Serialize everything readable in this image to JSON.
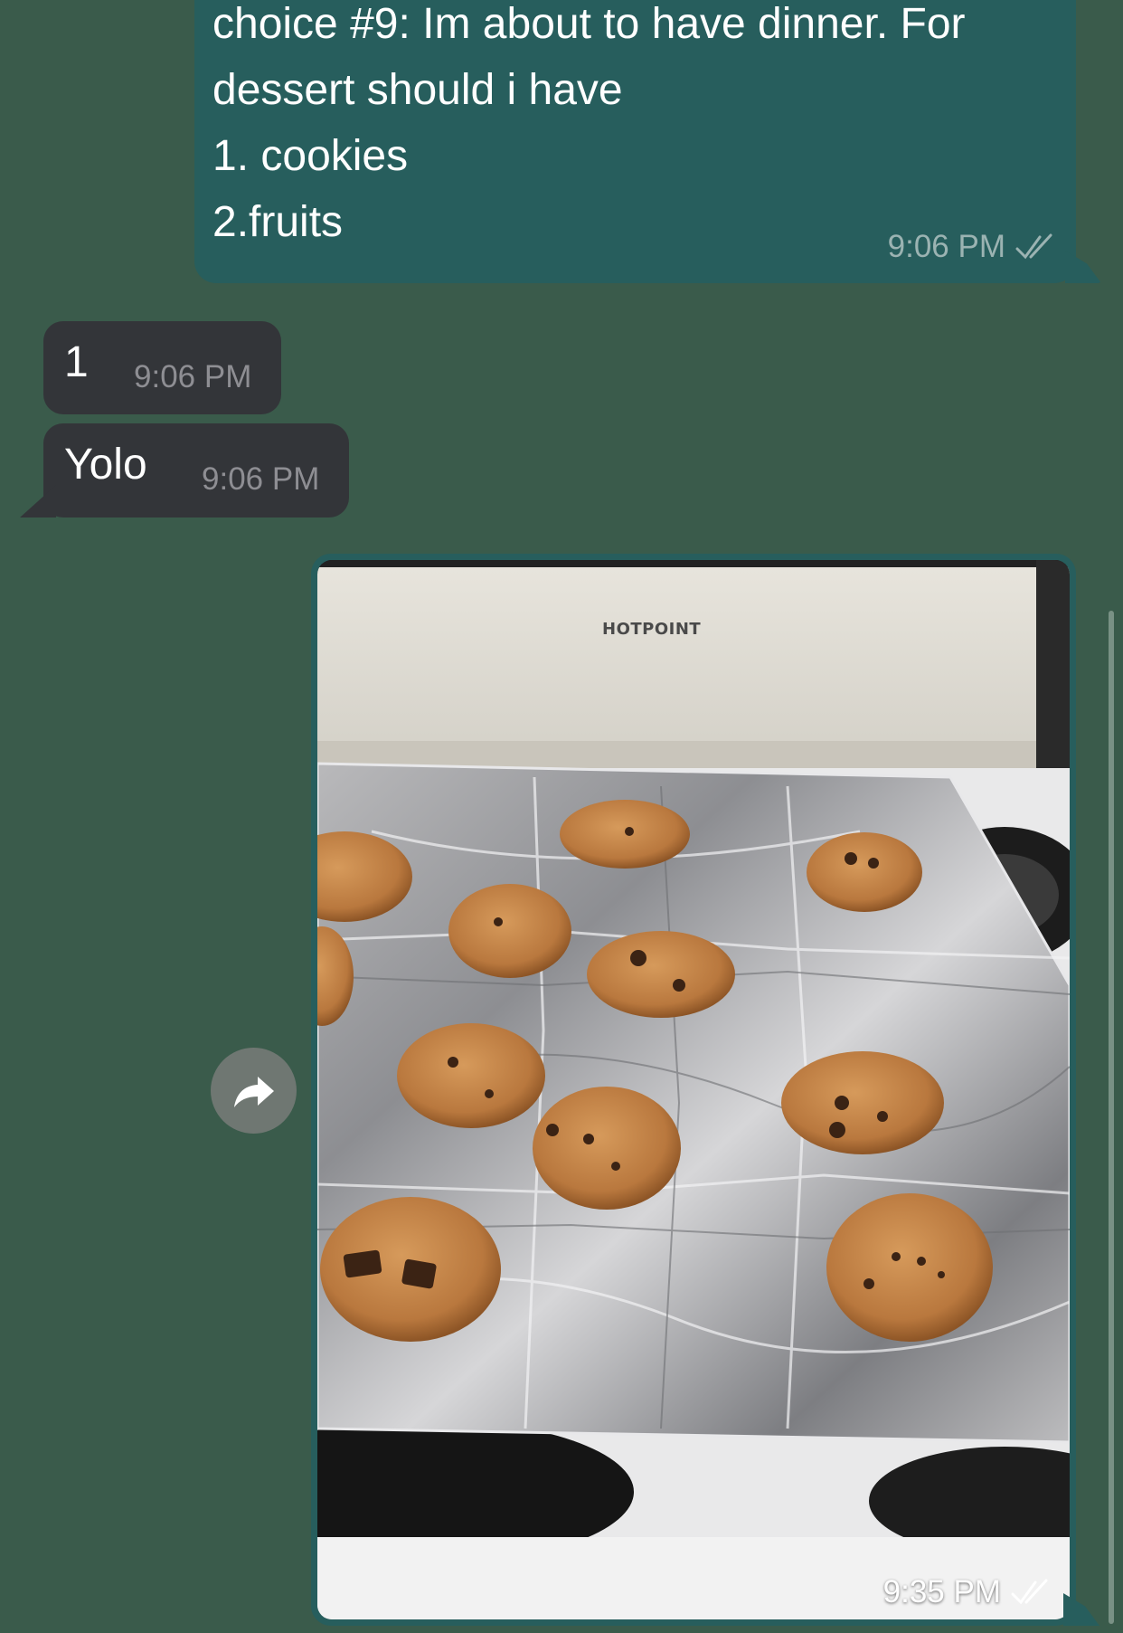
{
  "conversation": {
    "outgoing_poll": {
      "lines": [
        "choice #9: Im about to have dinner. For",
        "dessert should i have",
        "1. cookies",
        "2.fruits"
      ],
      "time": "9:06 PM",
      "status_icon": "double-check-icon"
    },
    "incoming_messages": [
      {
        "text": "1",
        "time": "9:06 PM"
      },
      {
        "text": "Yolo",
        "time": "9:06 PM"
      }
    ],
    "outgoing_photo": {
      "brand_text": "HOTPOINT",
      "time": "9:35 PM",
      "status_icon": "double-check-icon"
    },
    "forward_button": {
      "icon": "forward-arrow-icon"
    }
  },
  "colors": {
    "background": "#3a5b4b",
    "outgoing_bubble": "#275e5d",
    "incoming_bubble": "#333539",
    "text": "#ffffff",
    "outgoing_meta": "#9bb3b2",
    "incoming_meta": "#8e8e93"
  }
}
